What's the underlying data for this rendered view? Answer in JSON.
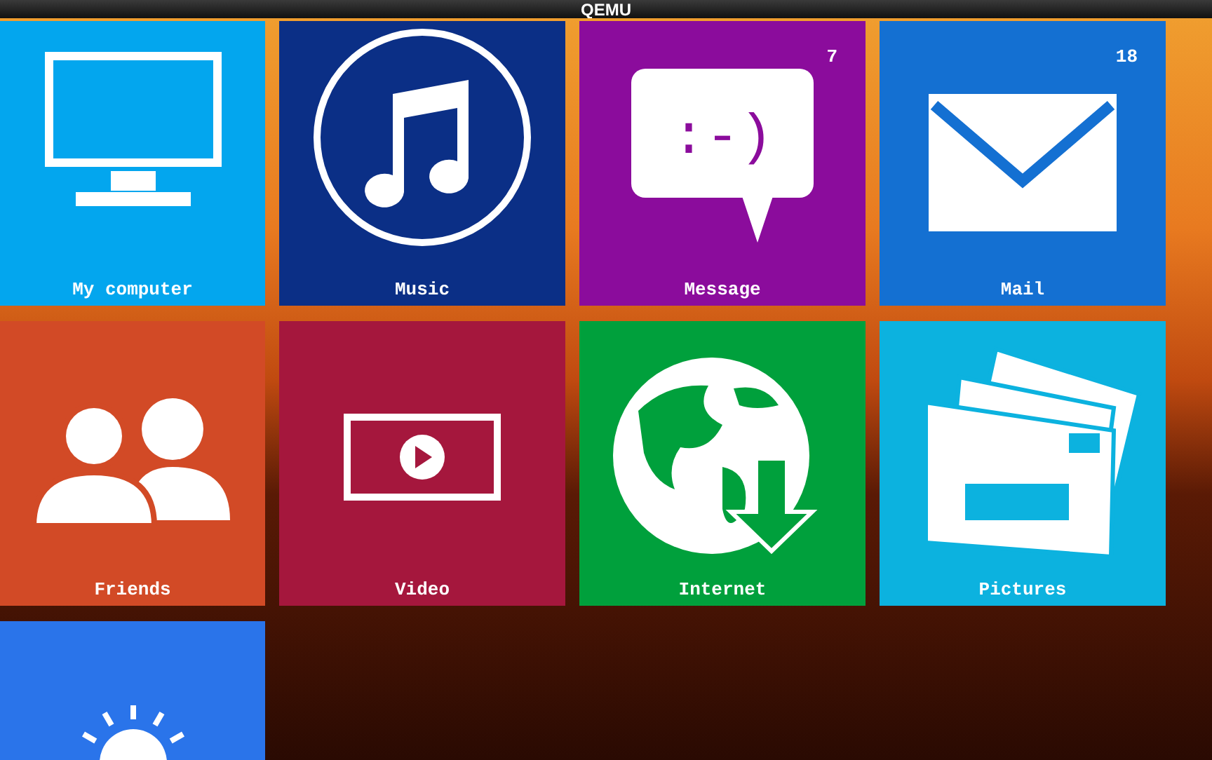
{
  "window": {
    "title": "QEMU"
  },
  "tiles": [
    {
      "kind": "monitor",
      "label": "My computer",
      "color": "#03a6ee"
    },
    {
      "kind": "music",
      "label": "Music",
      "color": "#0b2f86"
    },
    {
      "kind": "message",
      "label": "Message",
      "color": "#8b0c9c",
      "badge": "7",
      "bubble_text": ":-)"
    },
    {
      "kind": "mail",
      "label": "Mail",
      "color": "#1470d2",
      "badge": "18"
    },
    {
      "kind": "friends",
      "label": "Friends",
      "color": "#d24a26"
    },
    {
      "kind": "video",
      "label": "Video",
      "color": "#a5173d"
    },
    {
      "kind": "internet",
      "label": "Internet",
      "color": "#00a03c"
    },
    {
      "kind": "pictures",
      "label": "Pictures",
      "color": "#0cb2df"
    },
    {
      "kind": "weather",
      "color": "#2a74ea"
    }
  ]
}
